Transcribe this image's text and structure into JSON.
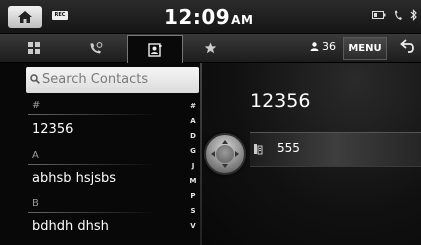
{
  "status_bar": {
    "rec_label": "REC",
    "time": "12:09",
    "ampm": "AM",
    "icons": [
      "home-icon",
      "rec-icon",
      "battery-icon",
      "phone-signal-icon",
      "bluetooth-icon"
    ]
  },
  "tab_bar": {
    "tabs": [
      "dialpad-icon",
      "recent-calls-icon",
      "contacts-icon",
      "favorites-icon"
    ],
    "active_tab": "contacts-icon",
    "contact_count": "36",
    "menu_label": "MENU"
  },
  "contacts": {
    "search_placeholder": "Search Contacts",
    "groups": [
      {
        "header": "#",
        "name": "12356"
      },
      {
        "header": "A",
        "name": "abhsb hsjsbs"
      },
      {
        "header": "B",
        "name": "bdhdh dhsh"
      }
    ],
    "alpha_index": [
      "#",
      "A",
      "D",
      "G",
      "J",
      "M",
      "P",
      "S",
      "V"
    ]
  },
  "detail": {
    "name": "12356",
    "phone_number": "555",
    "phone_type_icon": "home-phone-icon"
  },
  "colors": {
    "background": "#070707",
    "text": "#ffffff",
    "search_bg": "#eeeeee",
    "header_text": "#9a9a9a"
  }
}
